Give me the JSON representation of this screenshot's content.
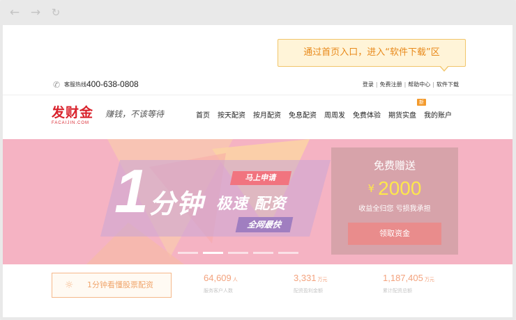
{
  "browser": {
    "back_icon": "back-arrow-icon",
    "forward_icon": "forward-arrow-icon",
    "reload_icon": "reload-icon"
  },
  "callout": {
    "text": "通过首页入口，进入“软件下载”区"
  },
  "topbar": {
    "hotline_label": "客服热线",
    "hotline_number": "400-638-0808",
    "links": [
      "登录",
      "免费注册",
      "帮助中心",
      "软件下载"
    ]
  },
  "header": {
    "logo_cn": "发财金",
    "logo_en": "FACAIJIN.COM",
    "slogan": "赚钱，不该等待",
    "nav": [
      "首页",
      "按天配资",
      "按月配资",
      "免息配资",
      "周周发",
      "免费体验",
      "期货实盘",
      "我的账户"
    ],
    "new_badge": "新"
  },
  "banner": {
    "one": "1",
    "minute": "分钟",
    "speed": "极速 配资",
    "tagline": "马上申请",
    "lowest": "全网最快",
    "gift_title": "免费赠送",
    "gift_currency": "¥",
    "gift_amount": "2000",
    "gift_sub": "收益全归您  亏损我承担",
    "gift_button": "领取资金",
    "slide_count": 5,
    "active_slide": 2,
    "colors": {
      "background": "#f5b3c3",
      "accent_yellow": "#fde74c"
    }
  },
  "stats": {
    "learn_label": "1分钟看懂股票配资",
    "items": [
      {
        "value": "64,609",
        "unit": "人",
        "caption": "服务客户人数"
      },
      {
        "value": "3,331",
        "unit": "万元",
        "caption": "配资盈利金额"
      },
      {
        "value": "1,187,405",
        "unit": "万元",
        "caption": "累计配资总额"
      }
    ]
  }
}
